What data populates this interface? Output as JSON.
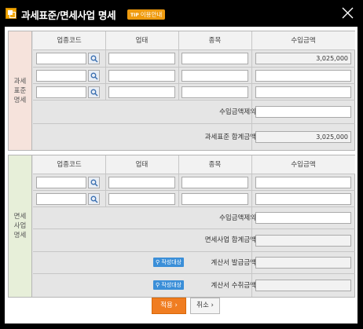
{
  "window": {
    "title": "과세표준/면세사업 명세",
    "tip_badge_prefix": "TIP",
    "tip_badge_label": "이용안내"
  },
  "columns": {
    "code": "업종코드",
    "business": "업태",
    "item": "종목",
    "income": "수입금액"
  },
  "taxable": {
    "label_lines": [
      "과세",
      "표준",
      "명세"
    ],
    "rows": [
      {
        "code": "",
        "business": "",
        "item": "",
        "income": "3,025,000"
      },
      {
        "code": "",
        "business": "",
        "item": "",
        "income": ""
      },
      {
        "code": "",
        "business": "",
        "item": "",
        "income": ""
      }
    ],
    "excluded_label": "수입금액제외",
    "excluded_value": "",
    "total_label": "과세표준 합계금액",
    "total_value": "3,025,000"
  },
  "exempt": {
    "label_lines": [
      "면세",
      "사업",
      "명세"
    ],
    "rows": [
      {
        "code": "",
        "business": "",
        "item": "",
        "income": ""
      },
      {
        "code": "",
        "business": "",
        "item": "",
        "income": ""
      }
    ],
    "excluded_label": "수입금액제외",
    "excluded_value": "",
    "total_label": "면세사업 합계금액",
    "total_value": "",
    "badge_label": "작성대상",
    "issued_label": "계산서 발급금액",
    "issued_value": "",
    "received_label": "계산서 수취금액",
    "received_value": ""
  },
  "buttons": {
    "apply": "적용",
    "cancel": "취소"
  },
  "colors": {
    "accent": "#f07d21",
    "taxable_label_bg": "#f6e3dc",
    "exempt_label_bg": "#e7efd9",
    "badge": "#3b8fd8"
  }
}
